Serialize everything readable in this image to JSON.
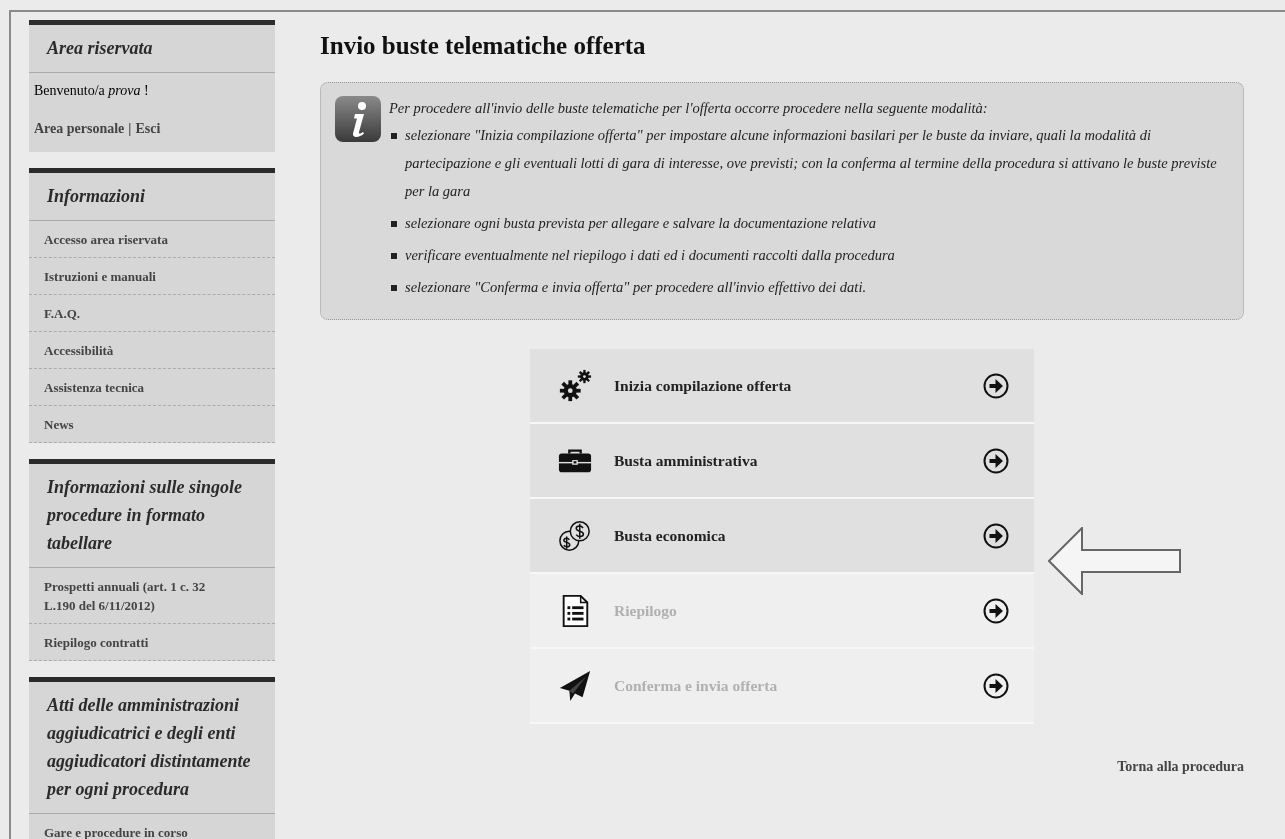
{
  "sidebar": {
    "panels": [
      {
        "kind": "welcome",
        "title": "Area riservata",
        "greeting": "Benvenuto/a *prova* !",
        "links": [
          "Area personale",
          "Esci"
        ],
        "separator": "|"
      },
      {
        "kind": "links",
        "title": "Informazioni",
        "items": [
          "Accesso area riservata",
          "Istruzioni e manuali",
          "F.A.Q.",
          "Accessibilità",
          "Assistenza tecnica",
          "News"
        ]
      },
      {
        "kind": "links",
        "title": "Informazioni sulle singole procedure in formato tabellare",
        "items": [
          "Prospetti annuali (art. 1 c. 32 L.190 del 6/11/2012)",
          "Riepilogo contratti"
        ]
      },
      {
        "kind": "links",
        "title": "Atti delle amministrazioni aggiudicatrici e degli enti aggiudicatori distintamente per ogni procedura",
        "items": [
          "Gare e procedure in corso"
        ]
      }
    ]
  },
  "main": {
    "title": "Invio buste telematiche offerta",
    "info": {
      "intro": "Per procedere all'invio delle buste telematiche per l'offerta occorre procedere nella seguente modalità:",
      "bullets": [
        "selezionare \"Inizia compilazione offerta\" per impostare alcune informazioni basilari per le buste da inviare, quali la modalità di partecipazione e gli eventuali lotti di gara di interesse, ove previsti; con la conferma al termine della procedura si attivano le buste previste per la gara",
        "selezionare ogni busta prevista per allegare e salvare la documentazione relativa",
        "verificare eventualmente nel riepilogo i dati ed i documenti raccolti dalla procedura",
        "selezionare \"Conferma e invia offerta\" per procedere all'invio effettivo dei dati."
      ]
    },
    "steps": [
      {
        "label": "Inizia compilazione offerta",
        "disabled": false
      },
      {
        "label": "Busta amministrativa",
        "disabled": false
      },
      {
        "label": "Busta economica",
        "disabled": false
      },
      {
        "label": "Riepilogo",
        "disabled": true
      },
      {
        "label": "Conferma e invia offerta",
        "disabled": true
      }
    ],
    "back_link": "Torna alla procedura"
  }
}
